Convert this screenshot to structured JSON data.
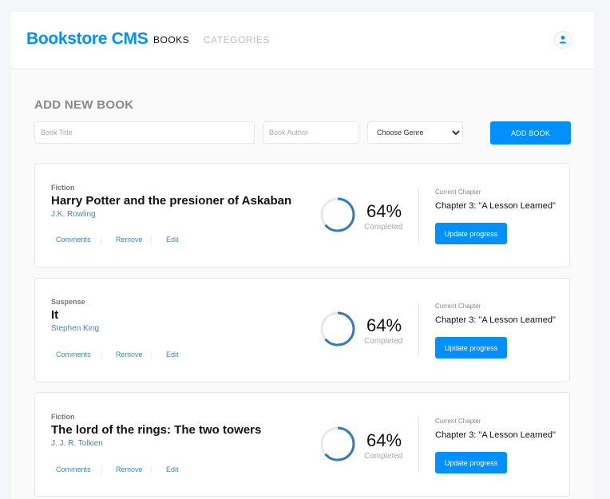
{
  "header": {
    "logo": "Bookstore CMS",
    "nav": [
      {
        "label": "BOOKS"
      },
      {
        "label": "CATEGORIES"
      }
    ],
    "user_icon": "user-icon"
  },
  "form": {
    "title": "ADD NEW BOOK",
    "title_placeholder": "Book Title",
    "author_placeholder": "Book Author",
    "genre_selected": "Choose Genre",
    "button": "ADD BOOK"
  },
  "colors": {
    "accent": "#0290ff",
    "link": "#4386bf",
    "progress": "#307bbe",
    "track": "#e8e8e8"
  },
  "books": [
    {
      "genre": "Fiction",
      "title": "Harry Potter and the presioner of Askaban",
      "author": "J.K. Rowling",
      "actions": {
        "comments": "Comments",
        "sep1": "|",
        "remove": "Remove",
        "sep2": "|",
        "edit": "Edit"
      },
      "progress": 0.64,
      "percent": "64%",
      "completed_label": "Completed",
      "chapter_label": "Current Chapter",
      "chapter": "Chapter 3: \"A Lesson Learned\"",
      "update_button": "Update progress"
    },
    {
      "genre": "Suspense",
      "title": "It",
      "author": "Stephen King",
      "actions": {
        "comments": "Comments",
        "sep1": "|",
        "remove": "Remove",
        "sep2": "|",
        "edit": "Edit"
      },
      "progress": 0.64,
      "percent": "64%",
      "completed_label": "Completed",
      "chapter_label": "Current Chapter",
      "chapter": "Chapter 3: \"A Lesson Learned\"",
      "update_button": "Update progress"
    },
    {
      "genre": "Fiction",
      "title": "The lord of the rings: The two towers",
      "author": "J. J. R. Tolkien",
      "actions": {
        "comments": "Comments",
        "sep1": "|",
        "remove": "Remove",
        "sep2": "|",
        "edit": "Edit"
      },
      "progress": 0.64,
      "percent": "64%",
      "completed_label": "Completed",
      "chapter_label": "Current Chapter",
      "chapter": "Chapter 3: \"A Lesson Learned\"",
      "update_button": "Update progress"
    }
  ]
}
